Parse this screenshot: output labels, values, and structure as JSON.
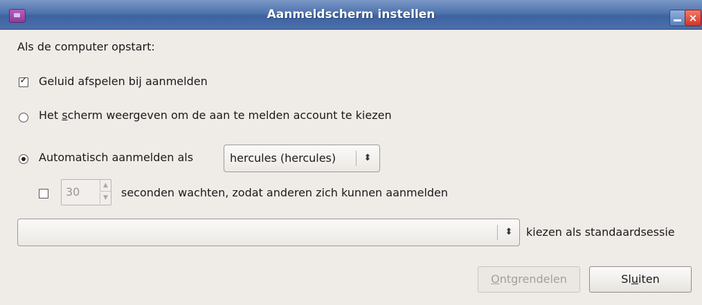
{
  "window": {
    "title": "Aanmeldscherm instellen",
    "close_glyph": "×"
  },
  "form": {
    "heading": "Als de computer opstart:",
    "play_sound": {
      "label": "Geluid afspelen bij aanmelden",
      "checked": true
    },
    "show_screen": {
      "label_pre": "Het ",
      "label_mnemonic": "s",
      "label_post": "cherm weergeven om de aan te melden account te kiezen",
      "selected": false
    },
    "auto_login": {
      "label": "Automatisch aanmelden als",
      "selected": true,
      "user_value": "hercules (hercules)"
    },
    "wait": {
      "checked": false,
      "seconds": "30",
      "label": "seconden wachten, zodat anderen zich kunnen aanmelden"
    },
    "session": {
      "value": "",
      "label": "kiezen als standaardsessie"
    }
  },
  "buttons": {
    "unlock": {
      "mnemonic": "O",
      "rest": "ntgrendelen",
      "enabled": false
    },
    "close": {
      "pre": "Sl",
      "mnemonic": "u",
      "post": "iten",
      "enabled": true
    }
  },
  "glyphs": {
    "checkmark": "✓",
    "combo_arrows": "⬍",
    "spin_up": "▲",
    "spin_down": "▼"
  }
}
